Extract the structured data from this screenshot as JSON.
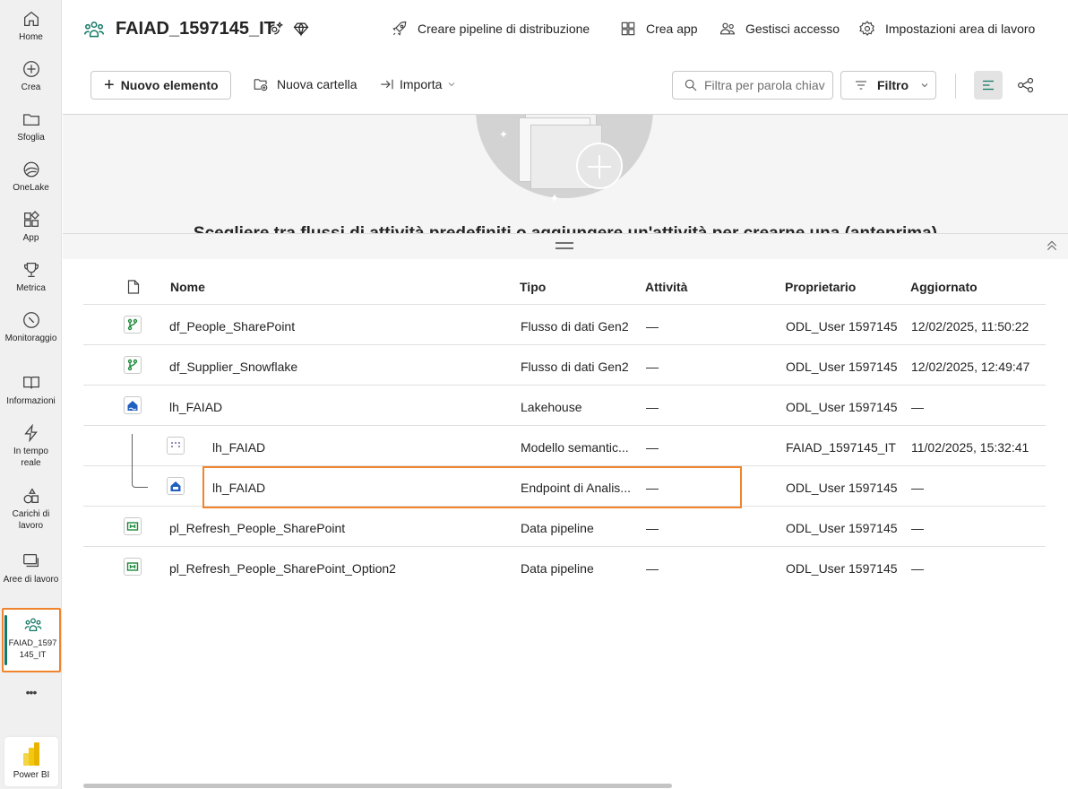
{
  "rail": {
    "items": [
      {
        "label": "Home",
        "icon": "home-icon"
      },
      {
        "label": "Crea",
        "icon": "create-icon"
      },
      {
        "label": "Sfoglia",
        "icon": "folder-icon"
      },
      {
        "label": "OneLake",
        "icon": "onelake-icon"
      },
      {
        "label": "App",
        "icon": "apps-icon"
      },
      {
        "label": "Metrica",
        "icon": "trophy-icon"
      },
      {
        "label": "Monitoraggio",
        "icon": "monitor-icon"
      },
      {
        "label": "Informazioni",
        "icon": "book-icon"
      },
      {
        "label": "In tempo reale",
        "icon": "lightning-icon"
      },
      {
        "label": "Carichi di lavoro",
        "icon": "workloads-icon"
      },
      {
        "label": "Aree di lavoro",
        "icon": "workspaces-icon"
      }
    ],
    "active_workspace": "FAIAD_1597145_IT",
    "more": "•••",
    "powerbi_label": "Power BI"
  },
  "header": {
    "title": "FAIAD_1597145_IT",
    "actions": [
      {
        "label": "Creare pipeline di distribuzione",
        "icon": "rocket-icon"
      },
      {
        "label": "Crea app",
        "icon": "app-icon"
      },
      {
        "label": "Gestisci accesso",
        "icon": "people-icon"
      },
      {
        "label": "Impostazioni area di lavoro",
        "icon": "gear-icon"
      }
    ]
  },
  "toolbar": {
    "new_item": "Nuovo elemento",
    "new_folder": "Nuova cartella",
    "import": "Importa",
    "search_placeholder": "Filtra per parola chiave",
    "filter": "Filtro"
  },
  "upper_panel": {
    "message": "Scegliere tra flussi di attività predefiniti o aggiungere un'attività per crearne una (anteprima)"
  },
  "table": {
    "columns": [
      "Nome",
      "Tipo",
      "Attività",
      "Proprietario",
      "Aggiornato"
    ],
    "rows": [
      {
        "name": "df_People_SharePoint",
        "type": "Flusso di dati Gen2",
        "activity": "—",
        "owner": "ODL_User 1597145",
        "updated": "12/02/2025, 11:50:22",
        "icon": "dataflow-icon"
      },
      {
        "name": "df_Supplier_Snowflake",
        "type": "Flusso di dati Gen2",
        "activity": "—",
        "owner": "ODL_User 1597145",
        "updated": "12/02/2025, 12:49:47",
        "icon": "dataflow-icon"
      },
      {
        "name": "lh_FAIAD",
        "type": "Lakehouse",
        "activity": "—",
        "owner": "ODL_User 1597145",
        "updated": "—",
        "icon": "lakehouse-icon"
      },
      {
        "name": "lh_FAIAD",
        "type": "Modello semantic...",
        "activity": "—",
        "owner": "FAIAD_1597145_IT",
        "updated": "11/02/2025, 15:32:41",
        "icon": "semantic-model-icon",
        "child": true
      },
      {
        "name": "lh_FAIAD",
        "type": "Endpoint di Analis...",
        "activity": "—",
        "owner": "ODL_User 1597145",
        "updated": "—",
        "icon": "sql-endpoint-icon",
        "child": true
      },
      {
        "name": "pl_Refresh_People_SharePoint",
        "type": "Data pipeline",
        "activity": "—",
        "owner": "ODL_User 1597145",
        "updated": "—",
        "icon": "pipeline-icon"
      },
      {
        "name": "pl_Refresh_People_SharePoint_Option2",
        "type": "Data pipeline",
        "activity": "—",
        "owner": "ODL_User 1597145",
        "updated": "—",
        "icon": "pipeline-icon"
      }
    ]
  },
  "colors": {
    "accent": "#117865",
    "highlight": "#f0842c"
  }
}
